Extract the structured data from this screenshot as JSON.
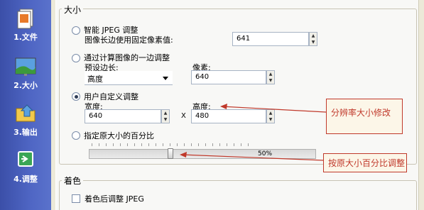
{
  "sidebar": {
    "items": [
      {
        "label": "1.文件",
        "icon": "file-icon"
      },
      {
        "label": "2.大小",
        "icon": "size-icon"
      },
      {
        "label": "3.输出",
        "icon": "folder-icon"
      },
      {
        "label": "4.调整",
        "icon": "adjust-icon"
      }
    ]
  },
  "size_group": {
    "title": "大小",
    "smart": {
      "label": "智能 JPEG 调整",
      "sub_label": "图像长边使用固定像素值:",
      "value": "641"
    },
    "one_side": {
      "label": "通过计算图像的一边调整",
      "edge_label": "预设边长:",
      "edge_value": "高度",
      "pixels_label": "像素:",
      "pixels_value": "640"
    },
    "custom": {
      "label": "用户自定义调整",
      "width_label": "宽度:",
      "width_value": "640",
      "x_label": "X",
      "height_label": "高度:",
      "height_value": "480"
    },
    "percent": {
      "label": "指定原大小的百分比",
      "value_text": "50%",
      "fraction": 0.5
    }
  },
  "color_group": {
    "title": "着色",
    "checkbox_label": "着色后调整 JPEG"
  },
  "annotations": {
    "resolution": "分辨率大小修改",
    "percent": "按原大小百分比调整"
  },
  "colors": {
    "annotation": "#c0392b",
    "sidebar": "#4f66c4"
  }
}
